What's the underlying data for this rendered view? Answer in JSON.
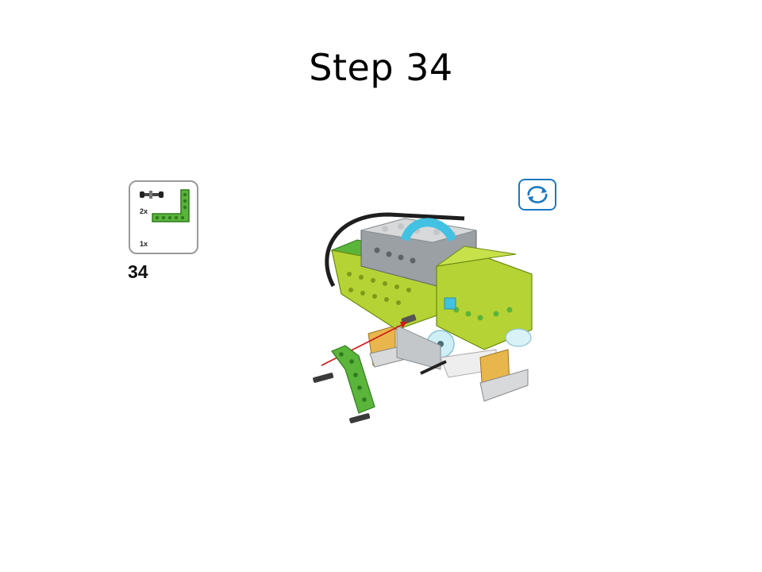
{
  "slide": {
    "title": "Step 34"
  },
  "parts_callout": {
    "items": [
      {
        "icon": "axle-pin-icon",
        "quantity": "2x"
      },
      {
        "icon": "green-l-beam-icon",
        "quantity": "1x"
      }
    ]
  },
  "step": {
    "number": "34"
  },
  "controls": {
    "rotate_icon": "rotate-arrows-icon"
  },
  "colors": {
    "lime": "#b5d334",
    "green": "#5ab53a",
    "gray": "#9aa0a4",
    "light_gray": "#d7d9da",
    "azure": "#43c1e2",
    "tan": "#e8b64c",
    "accent_blue": "#1c79c0"
  }
}
